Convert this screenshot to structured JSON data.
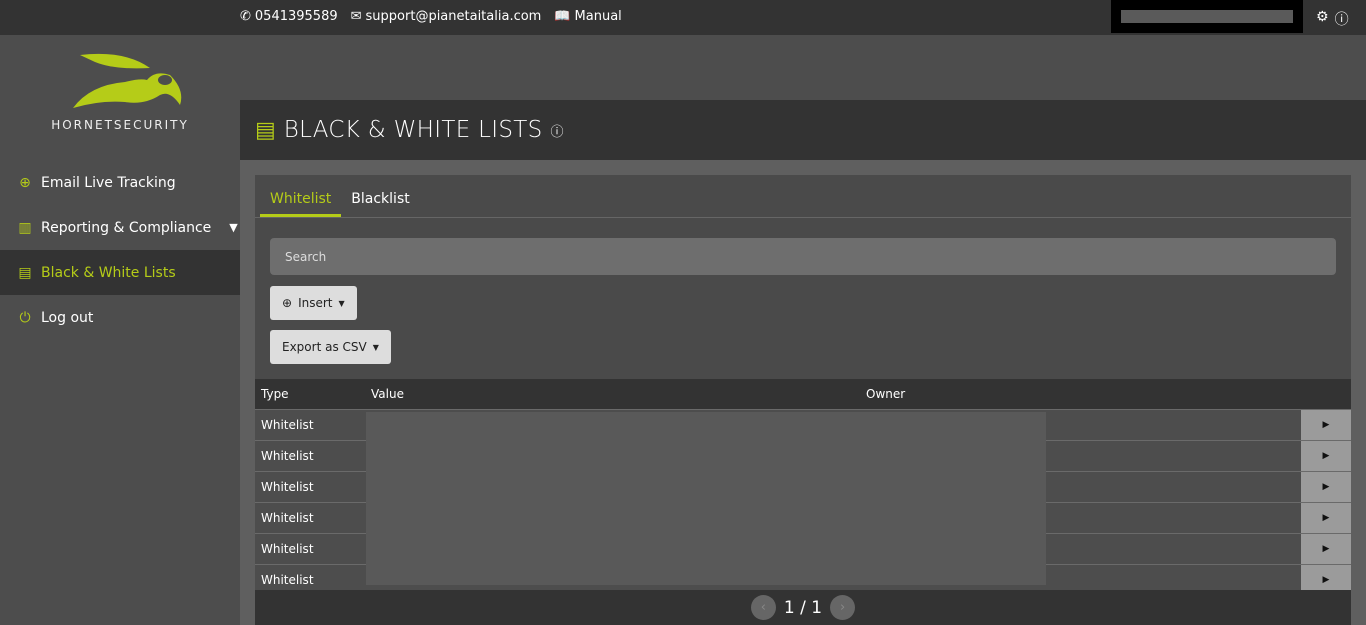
{
  "topbar": {
    "phone": "0541395589",
    "email": "support@pianetaitalia.com",
    "manual": "Manual"
  },
  "brand": {
    "name": "HORNETSECURITY",
    "accent": "#b5cc18"
  },
  "sidebar": {
    "items": [
      {
        "label": "Email Live Tracking",
        "icon": "search-plus-icon"
      },
      {
        "label": "Reporting & Compliance",
        "icon": "bar-chart-icon"
      },
      {
        "label": "Black & White Lists",
        "icon": "list-icon",
        "active": true
      },
      {
        "label": "Log out",
        "icon": "power-icon"
      }
    ]
  },
  "page": {
    "title": "BLACK & WHITE LISTS"
  },
  "tabs": [
    {
      "label": "Whitelist",
      "active": true
    },
    {
      "label": "Blacklist"
    }
  ],
  "search": {
    "placeholder": "Search"
  },
  "buttons": {
    "insert": "Insert",
    "export": "Export as CSV"
  },
  "table": {
    "headers": [
      "Type",
      "Value",
      "Owner"
    ],
    "rows": [
      {
        "type": "Whitelist"
      },
      {
        "type": "Whitelist"
      },
      {
        "type": "Whitelist"
      },
      {
        "type": "Whitelist"
      },
      {
        "type": "Whitelist"
      },
      {
        "type": "Whitelist"
      }
    ]
  },
  "pagination": {
    "label": "1 / 1"
  }
}
